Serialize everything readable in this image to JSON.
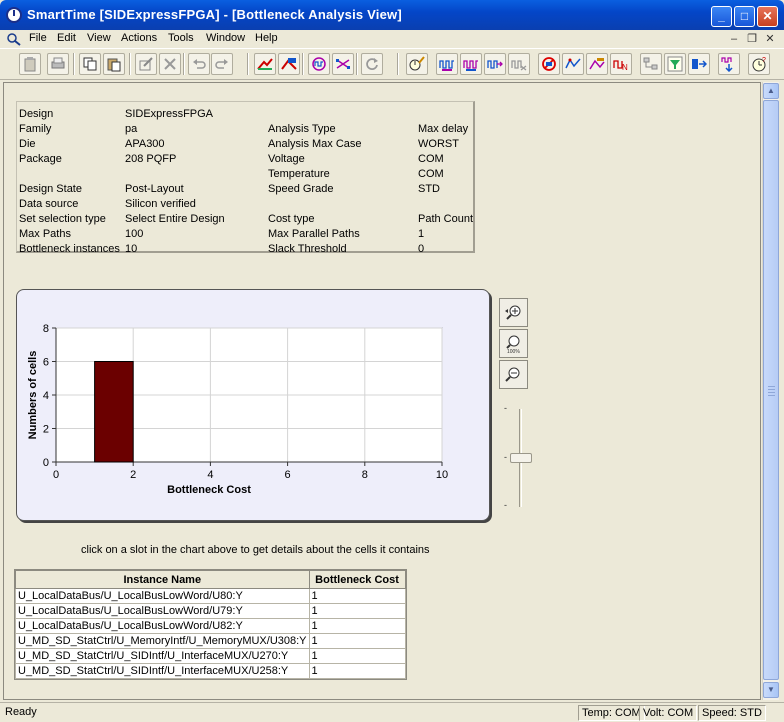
{
  "window": {
    "title": "SmartTime [SIDExpressFPGA] - [Bottleneck Analysis View]"
  },
  "menu": [
    "File",
    "Edit",
    "View",
    "Actions",
    "Tools",
    "Window",
    "Help"
  ],
  "info": {
    "left": [
      {
        "label": "Design",
        "value": "SIDExpressFPGA"
      },
      {
        "label": "Family",
        "value": "pa"
      },
      {
        "label": "Die",
        "value": "APA300"
      },
      {
        "label": "Package",
        "value": "208 PQFP"
      },
      {
        "label": "Design State",
        "value": "Post-Layout"
      },
      {
        "label": "Data source",
        "value": "Silicon verified"
      },
      {
        "label": "Set selection type",
        "value": "Select Entire Design"
      },
      {
        "label": "Max Paths",
        "value": "100"
      },
      {
        "label": "Bottleneck instances",
        "value": "10"
      }
    ],
    "right": [
      {
        "label": "Analysis Type",
        "value": "Max delay"
      },
      {
        "label": "Analysis Max Case",
        "value": "WORST"
      },
      {
        "label": "Voltage",
        "value": "COM"
      },
      {
        "label": "Temperature",
        "value": "COM"
      },
      {
        "label": "Speed Grade",
        "value": "STD"
      },
      {
        "label": "Cost type",
        "value": "Path Count"
      },
      {
        "label": "Max Parallel Paths",
        "value": "1"
      },
      {
        "label": "Slack Threshold",
        "value": "0"
      }
    ]
  },
  "chart_data": {
    "type": "bar",
    "bars": [
      {
        "x_start": 1,
        "x_end": 2,
        "value": 6
      }
    ],
    "xlabel": "Bottleneck Cost",
    "ylabel": "Numbers of cells",
    "xlim": [
      0,
      10
    ],
    "ylim": [
      0,
      8
    ],
    "xticks": [
      "0",
      "2",
      "4",
      "6",
      "8",
      "10"
    ],
    "yticks": [
      "0",
      "2",
      "4",
      "6",
      "8"
    ],
    "grid": true,
    "bar_color": "#6b0000"
  },
  "zoom": {
    "slider_ticks": [
      "-",
      "-",
      "-"
    ]
  },
  "hint": "click on a slot in the chart above to get details about the cells it contains",
  "table": {
    "columns": [
      "Instance Name",
      "Bottleneck Cost"
    ],
    "rows": [
      [
        "U_LocalDataBus/U_LocalBusLowWord/U80:Y",
        "1"
      ],
      [
        "U_LocalDataBus/U_LocalBusLowWord/U79:Y",
        "1"
      ],
      [
        "U_LocalDataBus/U_LocalBusLowWord/U82:Y",
        "1"
      ],
      [
        "U_MD_SD_StatCtrl/U_MemoryIntf/U_MemoryMUX/U308:Y",
        "1"
      ],
      [
        "U_MD_SD_StatCtrl/U_SIDIntf/U_InterfaceMUX/U270:Y",
        "1"
      ],
      [
        "U_MD_SD_StatCtrl/U_SIDIntf/U_InterfaceMUX/U258:Y",
        "1"
      ]
    ]
  },
  "status": {
    "ready": "Ready",
    "temp": "Temp: COM",
    "volt": "Volt: COM",
    "speed": "Speed: STD"
  }
}
